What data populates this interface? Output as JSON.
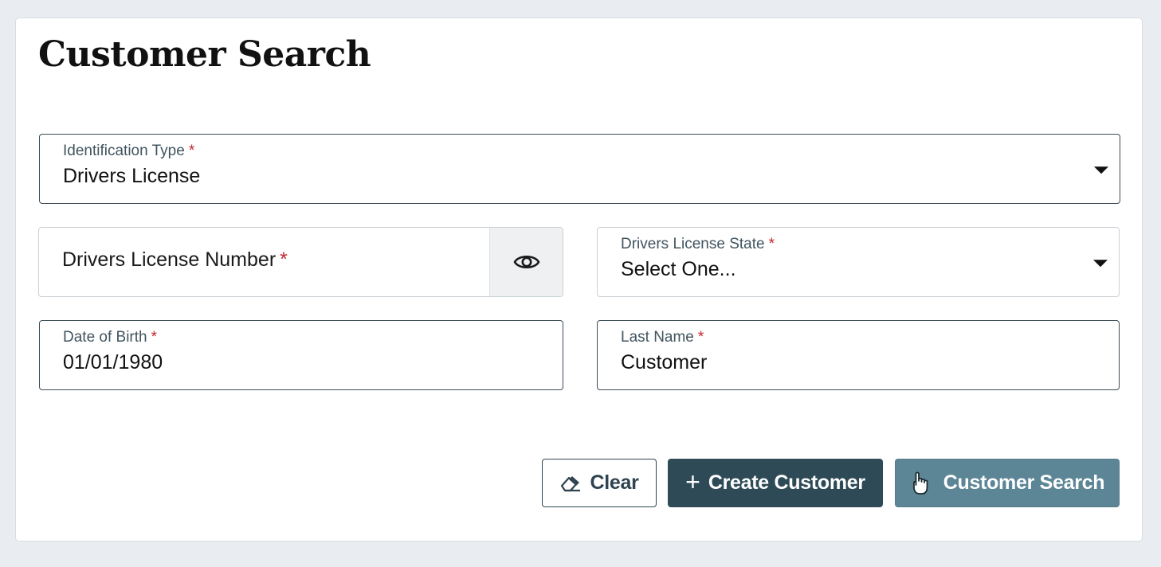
{
  "page": {
    "title": "Customer Search"
  },
  "form": {
    "identification_type": {
      "label": "Identification Type",
      "required_marker": "*",
      "value": "Drivers License"
    },
    "drivers_license_number": {
      "label": "Drivers License Number",
      "required_marker": "*",
      "toggle_icon": "eye-icon"
    },
    "drivers_license_state": {
      "label": "Drivers License State",
      "required_marker": "*",
      "value": "Select One..."
    },
    "date_of_birth": {
      "label": "Date of Birth",
      "required_marker": "*",
      "value": "01/01/1980"
    },
    "last_name": {
      "label": "Last Name",
      "required_marker": "*",
      "value": "Customer"
    }
  },
  "actions": {
    "clear_label": "Clear",
    "clear_icon": "eraser-icon",
    "create_label": "Create Customer",
    "create_icon": "plus-icon",
    "search_label": "Customer Search",
    "search_icon": "hand-pointer-icon"
  },
  "colors": {
    "required": "#c4262e",
    "primary_dark": "#2e4a57",
    "primary_light": "#5c8596",
    "field_border": "#3b4c57"
  }
}
